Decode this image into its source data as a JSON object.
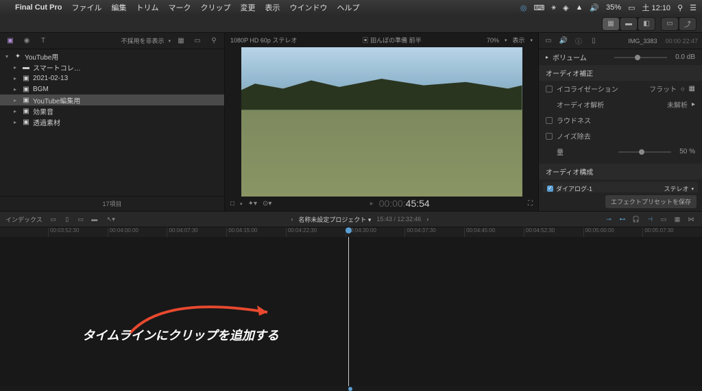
{
  "menubar": {
    "app": "Final Cut Pro",
    "items": [
      "ファイル",
      "編集",
      "トリム",
      "マーク",
      "クリップ",
      "変更",
      "表示",
      "ウインドウ",
      "ヘルプ"
    ],
    "battery": "35%",
    "clock": "土 12:10"
  },
  "browser": {
    "filter_label": "不採用を非表示",
    "library": "YouTube用",
    "items": [
      {
        "icon": "folder",
        "label": "スマートコレ…"
      },
      {
        "icon": "event",
        "label": "2021-02-13"
      },
      {
        "icon": "event",
        "label": "BGM"
      },
      {
        "icon": "event",
        "label": "YouTube編集用",
        "selected": true
      },
      {
        "icon": "event",
        "label": "効果音"
      },
      {
        "icon": "event",
        "label": "透過素材"
      }
    ],
    "footer": "17項目"
  },
  "viewer": {
    "format": "1080P HD 60p ステレオ",
    "title": "田んぼの準備 前半",
    "zoom": "70%",
    "view_menu": "表示",
    "time_prefix": "00:00:",
    "time": "45:54"
  },
  "inspector": {
    "clip_name": "IMG_3383",
    "duration": "00:00 22:47",
    "volume_label": "ボリューム",
    "volume_value": "0.0 dB",
    "audio_correction": "オーディオ補正",
    "eq_label": "イコライゼーション",
    "eq_value": "フラット",
    "analysis_label": "オーディオ解析",
    "analysis_value": "未解析",
    "loudness": "ラウドネス",
    "noise_label": "ノイズ除去",
    "amount_label": "量",
    "amount_value": "50 %",
    "audio_config": "オーディオ構成",
    "dialog_label": "ダイアログ-1",
    "stereo": "ステレオ",
    "preset_btn": "エフェクトプリセットを保存"
  },
  "timeline": {
    "index_label": "インデックス",
    "project": "名称未設定プロジェクト",
    "timecode": "15:43 / 12:32:46",
    "ruler": [
      "00:03:52:30",
      "00:04:00:00",
      "00:04:07:30",
      "00:04:15:00",
      "00:04:22:30",
      "00:04:30:00",
      "00:04:37:30",
      "00:04:45:00",
      "00:04:52:30",
      "00:05:00:00",
      "00:05:07:30"
    ]
  },
  "annotation": "タイムラインにクリップを追加する"
}
